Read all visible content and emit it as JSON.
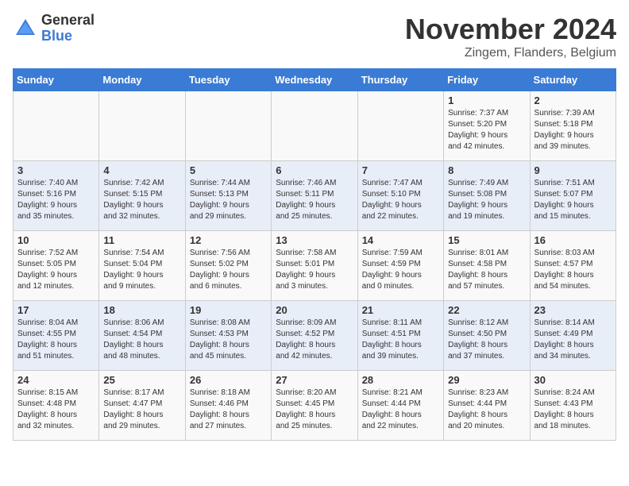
{
  "logo": {
    "general": "General",
    "blue": "Blue"
  },
  "title": "November 2024",
  "location": "Zingem, Flanders, Belgium",
  "days_of_week": [
    "Sunday",
    "Monday",
    "Tuesday",
    "Wednesday",
    "Thursday",
    "Friday",
    "Saturday"
  ],
  "weeks": [
    [
      {
        "day": "",
        "info": ""
      },
      {
        "day": "",
        "info": ""
      },
      {
        "day": "",
        "info": ""
      },
      {
        "day": "",
        "info": ""
      },
      {
        "day": "",
        "info": ""
      },
      {
        "day": "1",
        "info": "Sunrise: 7:37 AM\nSunset: 5:20 PM\nDaylight: 9 hours\nand 42 minutes."
      },
      {
        "day": "2",
        "info": "Sunrise: 7:39 AM\nSunset: 5:18 PM\nDaylight: 9 hours\nand 39 minutes."
      }
    ],
    [
      {
        "day": "3",
        "info": "Sunrise: 7:40 AM\nSunset: 5:16 PM\nDaylight: 9 hours\nand 35 minutes."
      },
      {
        "day": "4",
        "info": "Sunrise: 7:42 AM\nSunset: 5:15 PM\nDaylight: 9 hours\nand 32 minutes."
      },
      {
        "day": "5",
        "info": "Sunrise: 7:44 AM\nSunset: 5:13 PM\nDaylight: 9 hours\nand 29 minutes."
      },
      {
        "day": "6",
        "info": "Sunrise: 7:46 AM\nSunset: 5:11 PM\nDaylight: 9 hours\nand 25 minutes."
      },
      {
        "day": "7",
        "info": "Sunrise: 7:47 AM\nSunset: 5:10 PM\nDaylight: 9 hours\nand 22 minutes."
      },
      {
        "day": "8",
        "info": "Sunrise: 7:49 AM\nSunset: 5:08 PM\nDaylight: 9 hours\nand 19 minutes."
      },
      {
        "day": "9",
        "info": "Sunrise: 7:51 AM\nSunset: 5:07 PM\nDaylight: 9 hours\nand 15 minutes."
      }
    ],
    [
      {
        "day": "10",
        "info": "Sunrise: 7:52 AM\nSunset: 5:05 PM\nDaylight: 9 hours\nand 12 minutes."
      },
      {
        "day": "11",
        "info": "Sunrise: 7:54 AM\nSunset: 5:04 PM\nDaylight: 9 hours\nand 9 minutes."
      },
      {
        "day": "12",
        "info": "Sunrise: 7:56 AM\nSunset: 5:02 PM\nDaylight: 9 hours\nand 6 minutes."
      },
      {
        "day": "13",
        "info": "Sunrise: 7:58 AM\nSunset: 5:01 PM\nDaylight: 9 hours\nand 3 minutes."
      },
      {
        "day": "14",
        "info": "Sunrise: 7:59 AM\nSunset: 4:59 PM\nDaylight: 9 hours\nand 0 minutes."
      },
      {
        "day": "15",
        "info": "Sunrise: 8:01 AM\nSunset: 4:58 PM\nDaylight: 8 hours\nand 57 minutes."
      },
      {
        "day": "16",
        "info": "Sunrise: 8:03 AM\nSunset: 4:57 PM\nDaylight: 8 hours\nand 54 minutes."
      }
    ],
    [
      {
        "day": "17",
        "info": "Sunrise: 8:04 AM\nSunset: 4:55 PM\nDaylight: 8 hours\nand 51 minutes."
      },
      {
        "day": "18",
        "info": "Sunrise: 8:06 AM\nSunset: 4:54 PM\nDaylight: 8 hours\nand 48 minutes."
      },
      {
        "day": "19",
        "info": "Sunrise: 8:08 AM\nSunset: 4:53 PM\nDaylight: 8 hours\nand 45 minutes."
      },
      {
        "day": "20",
        "info": "Sunrise: 8:09 AM\nSunset: 4:52 PM\nDaylight: 8 hours\nand 42 minutes."
      },
      {
        "day": "21",
        "info": "Sunrise: 8:11 AM\nSunset: 4:51 PM\nDaylight: 8 hours\nand 39 minutes."
      },
      {
        "day": "22",
        "info": "Sunrise: 8:12 AM\nSunset: 4:50 PM\nDaylight: 8 hours\nand 37 minutes."
      },
      {
        "day": "23",
        "info": "Sunrise: 8:14 AM\nSunset: 4:49 PM\nDaylight: 8 hours\nand 34 minutes."
      }
    ],
    [
      {
        "day": "24",
        "info": "Sunrise: 8:15 AM\nSunset: 4:48 PM\nDaylight: 8 hours\nand 32 minutes."
      },
      {
        "day": "25",
        "info": "Sunrise: 8:17 AM\nSunset: 4:47 PM\nDaylight: 8 hours\nand 29 minutes."
      },
      {
        "day": "26",
        "info": "Sunrise: 8:18 AM\nSunset: 4:46 PM\nDaylight: 8 hours\nand 27 minutes."
      },
      {
        "day": "27",
        "info": "Sunrise: 8:20 AM\nSunset: 4:45 PM\nDaylight: 8 hours\nand 25 minutes."
      },
      {
        "day": "28",
        "info": "Sunrise: 8:21 AM\nSunset: 4:44 PM\nDaylight: 8 hours\nand 22 minutes."
      },
      {
        "day": "29",
        "info": "Sunrise: 8:23 AM\nSunset: 4:44 PM\nDaylight: 8 hours\nand 20 minutes."
      },
      {
        "day": "30",
        "info": "Sunrise: 8:24 AM\nSunset: 4:43 PM\nDaylight: 8 hours\nand 18 minutes."
      }
    ]
  ]
}
